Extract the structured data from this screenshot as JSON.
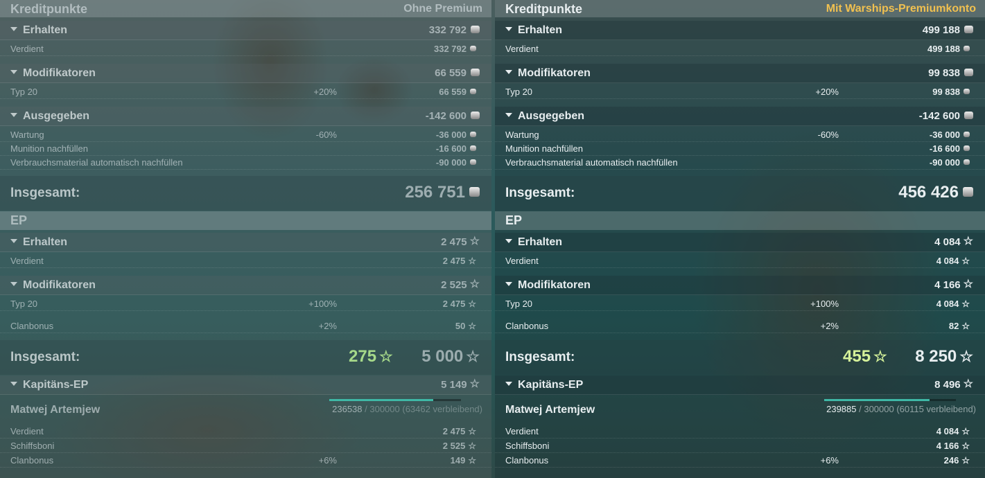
{
  "columns": [
    {
      "id": "left",
      "credits": {
        "title": "Kreditpunkte",
        "right_label": "Ohne Premium",
        "received": {
          "label": "Erhalten",
          "value": "332 792",
          "items": [
            {
              "label": "Verdient",
              "pct": "",
              "value": "332 792"
            }
          ]
        },
        "modifiers": {
          "label": "Modifikatoren",
          "value": "66 559",
          "items": [
            {
              "label": "Typ 20",
              "pct": "+20%",
              "value": "66 559"
            }
          ]
        },
        "spent": {
          "label": "Ausgegeben",
          "value": "-142 600",
          "items": [
            {
              "label": "Wartung",
              "pct": "-60%",
              "value": "-36 000"
            },
            {
              "label": "Munition nachfüllen",
              "pct": "",
              "value": "-16 600"
            },
            {
              "label": "Verbrauchsmaterial automatisch nachfüllen",
              "pct": "",
              "value": "-90 000"
            }
          ]
        },
        "total_label": "Insgesamt:",
        "total_value": "256 751"
      },
      "xp": {
        "title": "EP",
        "received": {
          "label": "Erhalten",
          "value": "2 475",
          "items": [
            {
              "label": "Verdient",
              "pct": "",
              "value": "2 475"
            }
          ]
        },
        "modifiers": {
          "label": "Modifikatoren",
          "value": "2 525",
          "items": [
            {
              "label": "Typ 20",
              "pct": "+100%",
              "value": "2 475"
            },
            {
              "label": "Clanbonus",
              "pct": "+2%",
              "value": "50"
            }
          ]
        },
        "total_label": "Insgesamt:",
        "total_bonus": "275",
        "total_value": "5 000",
        "captain": {
          "label": "Kapitäns-EP",
          "value": "5 149",
          "name": "Matwej Artemjew",
          "progress_current": "236538",
          "progress_rest": " / 300000 (63462 verbleibend)",
          "progress_fraction": 0.788,
          "items": [
            {
              "label": "Verdient",
              "pct": "",
              "value": "2 475"
            },
            {
              "label": "Schiffsboni",
              "pct": "",
              "value": "2 525"
            },
            {
              "label": "Clanbonus",
              "pct": "+6%",
              "value": "149"
            }
          ]
        }
      }
    },
    {
      "id": "right",
      "credits": {
        "title": "Kreditpunkte",
        "right_label": "Mit Warships-Premiumkonto",
        "received": {
          "label": "Erhalten",
          "value": "499 188",
          "items": [
            {
              "label": "Verdient",
              "pct": "",
              "value": "499 188"
            }
          ]
        },
        "modifiers": {
          "label": "Modifikatoren",
          "value": "99 838",
          "items": [
            {
              "label": "Typ 20",
              "pct": "+20%",
              "value": "99 838"
            }
          ]
        },
        "spent": {
          "label": "Ausgegeben",
          "value": "-142 600",
          "items": [
            {
              "label": "Wartung",
              "pct": "-60%",
              "value": "-36 000"
            },
            {
              "label": "Munition nachfüllen",
              "pct": "",
              "value": "-16 600"
            },
            {
              "label": "Verbrauchsmaterial automatisch nachfüllen",
              "pct": "",
              "value": "-90 000"
            }
          ]
        },
        "total_label": "Insgesamt:",
        "total_value": "456 426"
      },
      "xp": {
        "title": "EP",
        "received": {
          "label": "Erhalten",
          "value": "4 084",
          "items": [
            {
              "label": "Verdient",
              "pct": "",
              "value": "4 084"
            }
          ]
        },
        "modifiers": {
          "label": "Modifikatoren",
          "value": "4 166",
          "items": [
            {
              "label": "Typ 20",
              "pct": "+100%",
              "value": "4 084"
            },
            {
              "label": "Clanbonus",
              "pct": "+2%",
              "value": "82"
            }
          ]
        },
        "total_label": "Insgesamt:",
        "total_bonus": "455",
        "total_value": "8 250",
        "captain": {
          "label": "Kapitäns-EP",
          "value": "8 496",
          "name": "Matwej Artemjew",
          "progress_current": "239885",
          "progress_rest": " / 300000 (60115 verbleibend)",
          "progress_fraction": 0.8,
          "items": [
            {
              "label": "Verdient",
              "pct": "",
              "value": "4 084"
            },
            {
              "label": "Schiffsboni",
              "pct": "",
              "value": "4 166"
            },
            {
              "label": "Clanbonus",
              "pct": "+6%",
              "value": "246"
            }
          ]
        }
      }
    }
  ],
  "icons": {
    "credit": "credit-coin-icon",
    "xp": "star-icon",
    "expand": "triangle-down-icon"
  },
  "colors": {
    "premium_label": "#f0c050",
    "bonus_xp_left": "#a6d98a",
    "bonus_xp_right": "#d6f29a",
    "progress": "#3fb8a6"
  }
}
